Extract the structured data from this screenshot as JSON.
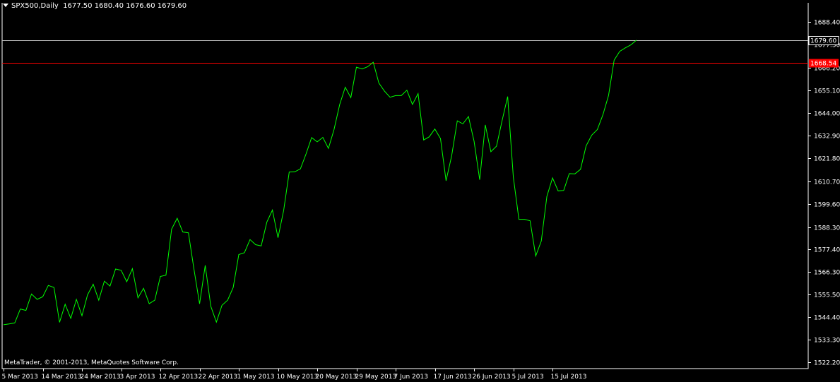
{
  "header": {
    "symbol": "SPX500,Daily",
    "ohlc": "1677.50 1680.40 1676.60 1679.60"
  },
  "footer": {
    "copyright": "MetaTrader, © 2001-2013, MetaQuotes Software Corp."
  },
  "colors": {
    "background": "#000000",
    "series": "#00ff00",
    "axis": "#ffffff",
    "level_line": "#ff0000",
    "bid_line": "#c0c0c0",
    "level_badge": "#ff0000"
  },
  "chart_data": {
    "type": "line",
    "title": "",
    "xlabel": "",
    "ylabel": "",
    "ylim": [
      1519.2,
      1697.8
    ],
    "y_ticks": [
      "1688.40",
      "1677.30",
      "1666.20",
      "1655.10",
      "1644.00",
      "1632.90",
      "1621.80",
      "1610.70",
      "1599.60",
      "1588.30",
      "1577.40",
      "1566.30",
      "1555.50",
      "1544.40",
      "1533.30",
      "1522.20"
    ],
    "x_ticks": [
      "5 Mar 2013",
      "14 Mar 2013",
      "24 Mar 2013",
      "3 Apr 2013",
      "12 Apr 2013",
      "22 Apr 2013",
      "1 May 2013",
      "10 May 2013",
      "20 May 2013",
      "29 May 2013",
      "7 Jun 2013",
      "17 Jun 2013",
      "26 Jun 2013",
      "5 Jul 2013",
      "15 Jul 2013"
    ],
    "levels": [
      {
        "label": "1679.60",
        "value": 1679.6,
        "kind": "bid"
      },
      {
        "label": "1668.54",
        "value": 1668.54,
        "kind": "level"
      }
    ],
    "grid": false,
    "series": [
      {
        "values": [
          1540.6,
          1541.0,
          1541.5,
          1548.3,
          1547.6,
          1555.6,
          1553.0,
          1554.3,
          1559.8,
          1558.8,
          1541.8,
          1550.6,
          1543.7,
          1553.0,
          1545.0,
          1555.2,
          1560.4,
          1552.6,
          1561.9,
          1559.5,
          1567.8,
          1567.2,
          1561.6,
          1568.0,
          1553.7,
          1558.4,
          1550.9,
          1552.6,
          1564.2,
          1564.8,
          1587.3,
          1592.6,
          1585.9,
          1585.5,
          1567.6,
          1550.8,
          1569.6,
          1549.6,
          1541.9,
          1550.1,
          1552.6,
          1558.8,
          1574.9,
          1575.8,
          1582.2,
          1579.7,
          1579.1,
          1590.7,
          1596.6,
          1583.1,
          1596.4,
          1615.2,
          1615.3,
          1616.7,
          1624.0,
          1632.0,
          1629.9,
          1632.1,
          1626.7,
          1635.9,
          1648.1,
          1656.6,
          1651.5,
          1666.4,
          1665.5,
          1666.6,
          1668.8,
          1658.6,
          1654.7,
          1651.7,
          1652.5,
          1652.5,
          1655.1,
          1648.2,
          1653.5,
          1630.8,
          1632.4,
          1636.2,
          1631.5,
          1610.9,
          1623.1,
          1640.2,
          1638.7,
          1642.3,
          1630.1,
          1611.4,
          1638.2,
          1625.1,
          1627.8,
          1640.3,
          1652.0,
          1612.7,
          1592.1,
          1592.1,
          1591.4,
          1574.2,
          1581.5,
          1603.3,
          1612.3,
          1606.0,
          1606.2,
          1614.4,
          1614.3,
          1616.5,
          1627.9,
          1633.2,
          1635.9,
          1643.1,
          1652.6,
          1669.8,
          1674.1,
          1675.8,
          1677.3,
          1679.6
        ]
      }
    ]
  }
}
